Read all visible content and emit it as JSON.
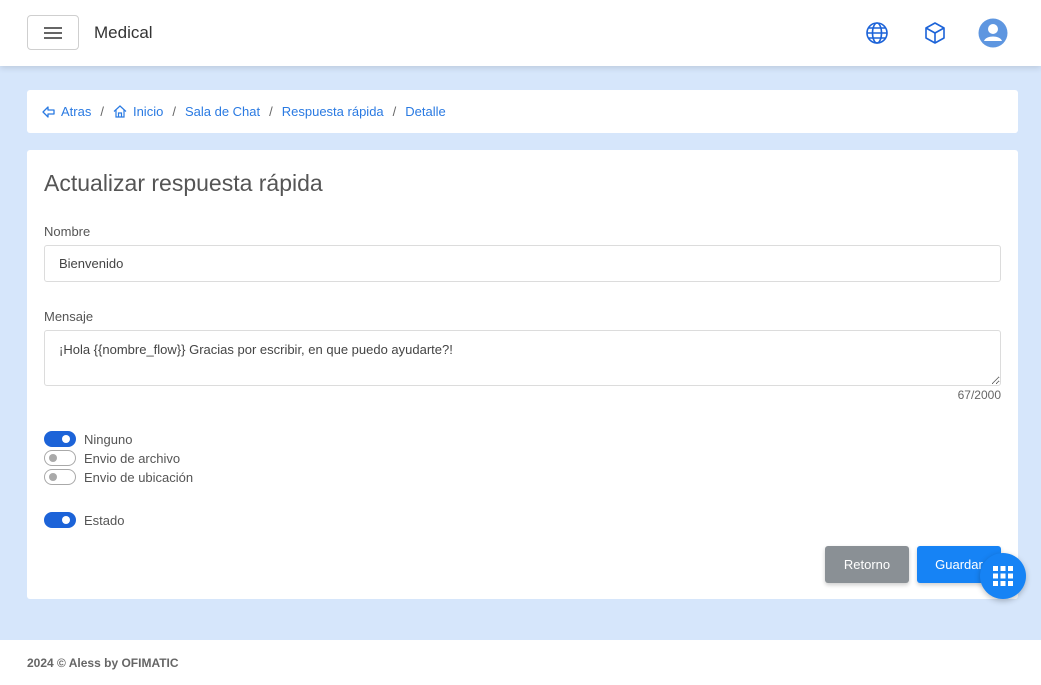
{
  "header": {
    "brand": "Medical",
    "icons": [
      "menu-icon",
      "globe-icon",
      "cube-icon",
      "user-avatar-icon"
    ],
    "accent": "#1c63d8"
  },
  "breadcrumb": {
    "back": "Atras",
    "items": [
      "Inicio",
      "Sala de Chat",
      "Respuesta rápida",
      "Detalle"
    ],
    "separator": "/"
  },
  "form": {
    "title": "Actualizar respuesta rápida",
    "name_label": "Nombre",
    "name_value": "Bienvenido",
    "message_label": "Mensaje",
    "message_value": "¡Hola {{nombre_flow}} Gracias por escribir, en que puedo ayudarte?!",
    "counter": "67/2000",
    "options": [
      {
        "label": "Ninguno",
        "on": true
      },
      {
        "label": "Envio de archivo",
        "on": false
      },
      {
        "label": "Envio de ubicación",
        "on": false
      }
    ],
    "status": {
      "label": "Estado",
      "on": true
    },
    "back_button": "Retorno",
    "save_button": "Guardar"
  },
  "footer": {
    "text": "2024 © Aless by OFIMATIC"
  }
}
